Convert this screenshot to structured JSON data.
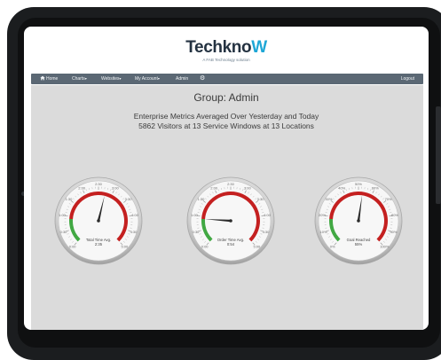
{
  "brand": {
    "name_main": "Techkno",
    "name_accent": "W",
    "tagline": "A FAB Technology solution"
  },
  "nav": {
    "home": "Home",
    "charts": "Charts",
    "websites": "Websites",
    "account": "My Account",
    "admin": "Admin",
    "gear": "⚙",
    "logout": "Logout",
    "caret": "▾"
  },
  "main": {
    "group_title": "Group: Admin",
    "metrics_line_1": "Enterprise Metrics Averaged Over Yesterday and Today",
    "metrics_line_2": "5862 Visitors at 13 Service Windows at 13 Locations"
  },
  "gauges": [
    {
      "label": "Total Time Avg.",
      "value_text": "2:35",
      "ticks": [
        "0:00",
        "0:30",
        "1:00",
        "1:30",
        "2:00",
        "2:30",
        "3:00",
        "3:30",
        "4:00",
        "4:30",
        "5:00"
      ],
      "needle_fraction": 0.55
    },
    {
      "label": "Order Time Avg.",
      "value_text": "0:54",
      "ticks": [
        "0:00",
        "0:30",
        "1:00",
        "1:30",
        "2:00",
        "2:30",
        "3:00",
        "3:30",
        "4:00",
        "4:30",
        "5:00"
      ],
      "needle_fraction": 0.18
    },
    {
      "label": "Goal Reached",
      "value_text": "55%",
      "ticks": [
        "0%",
        "10%",
        "20%",
        "30%",
        "40%",
        "50%",
        "60%",
        "70%",
        "80%",
        "90%",
        "100%"
      ],
      "needle_fraction": 0.53
    }
  ],
  "colors": {
    "green": "#41a843",
    "red": "#c42020",
    "navbar": "#5b6874",
    "accent": "#1fa7d6"
  }
}
